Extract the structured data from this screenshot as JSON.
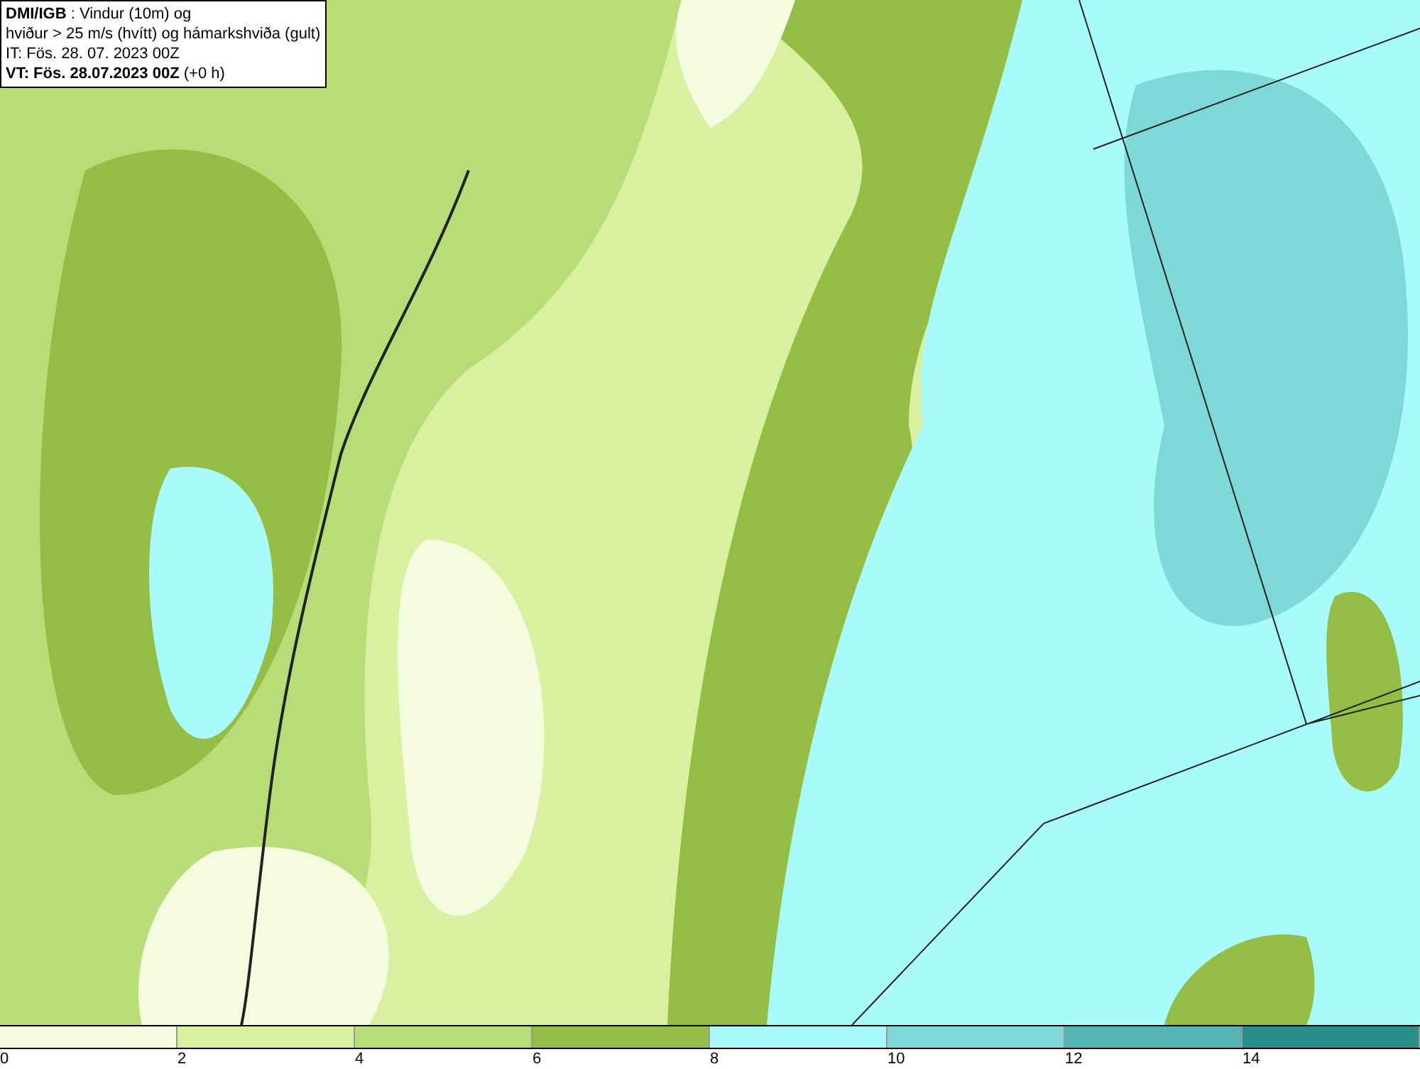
{
  "info_box": {
    "lines": [
      "**DMI/IGB** : Vindur (10m) og",
      "hviður > 25 m/s (hvítt) og hámarkshviða (gult)",
      "IT: Fös. 28. 07. 2023 00Z",
      "**VT: Fös. 28.07.2023 00Z** (+0 h)"
    ]
  },
  "legend": {
    "bins": [
      {
        "color": "#f4fbdf"
      },
      {
        "color": "#d8f0a0"
      },
      {
        "color": "#b7dc78"
      },
      {
        "color": "#93bd44"
      },
      {
        "color": "#a9fbfb"
      },
      {
        "color": "#7fd8d8"
      },
      {
        "color": "#55b4b4"
      },
      {
        "color": "#2a8f8a"
      }
    ],
    "ticks": [
      "0",
      "2",
      "4",
      "6",
      "8",
      "10",
      "12",
      "14"
    ]
  }
}
